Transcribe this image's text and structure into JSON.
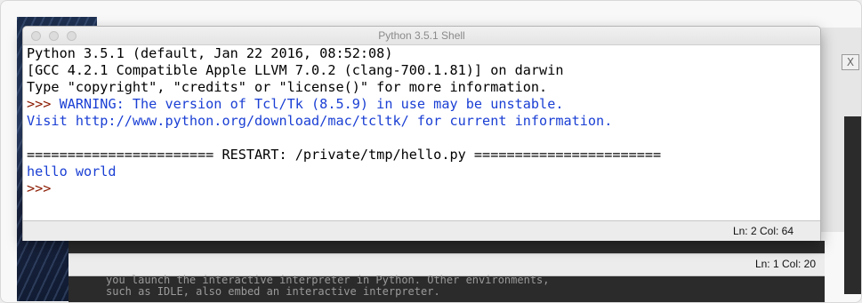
{
  "shell": {
    "title": "Python 3.5.1 Shell",
    "lines": [
      {
        "text": "Python 3.5.1 (default, Jan 22 2016, 08:52:08)",
        "kind": "out"
      },
      {
        "text": "[GCC 4.2.1 Compatible Apple LLVM 7.0.2 (clang-700.1.81)] on darwin",
        "kind": "out"
      },
      {
        "text": "Type \"copyright\", \"credits\" or \"license()\" for more information.",
        "kind": "out"
      },
      {
        "prompt": ">>> ",
        "text": "WARNING: The version of Tcl/Tk (8.5.9) in use may be unstable.",
        "kind": "warn"
      },
      {
        "text": "Visit http://www.python.org/download/mac/tcltk/ for current information.",
        "kind": "warn"
      },
      {
        "text": "",
        "kind": "out"
      },
      {
        "text": "======================= RESTART: /private/tmp/hello.py =======================",
        "kind": "out"
      },
      {
        "text": "hello world",
        "kind": "hello"
      },
      {
        "prompt": ">>>",
        "text": "",
        "kind": "prompt"
      }
    ],
    "status": "Ln: 2  Col: 64"
  },
  "editor": {
    "status": "Ln: 1  Col: 20",
    "text_line_1": "you launch the interactive interpreter in Python. Other environments,",
    "text_line_2": "such as IDLE, also embed an interactive interpreter."
  },
  "back_window": {
    "close_glyph": "X"
  }
}
